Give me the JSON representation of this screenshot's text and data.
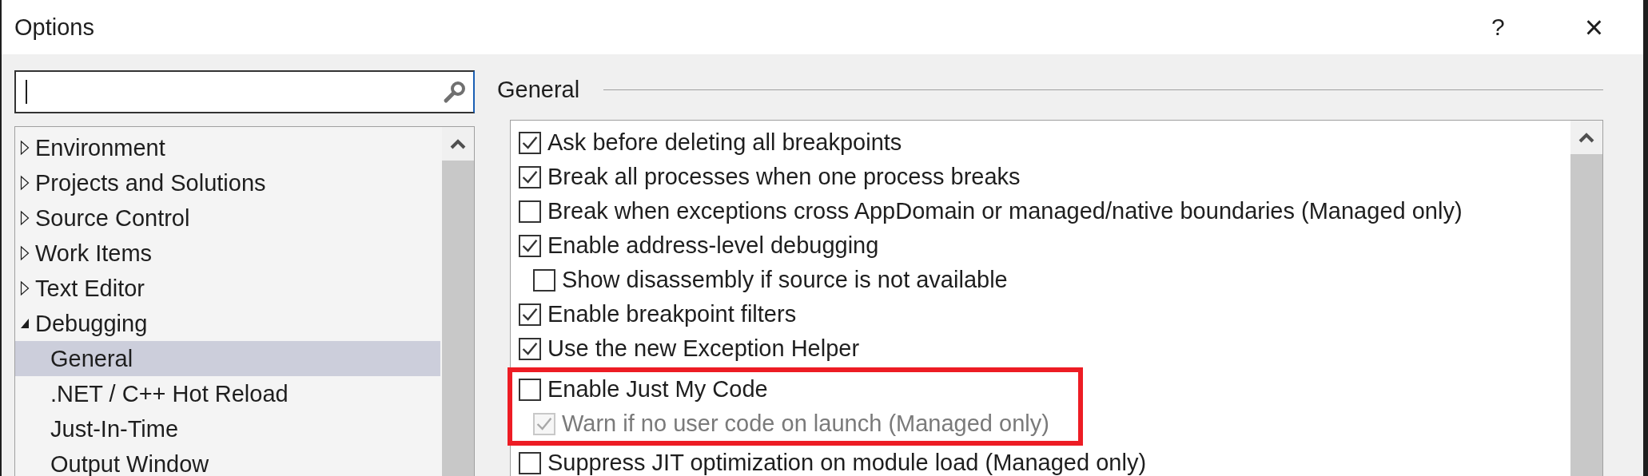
{
  "window": {
    "title": "Options",
    "help_button": "?",
    "close_button": "×"
  },
  "tree": [
    {
      "label": "Environment",
      "expanded": false,
      "selected": false
    },
    {
      "label": "Projects and Solutions",
      "expanded": false,
      "selected": false
    },
    {
      "label": "Source Control",
      "expanded": false,
      "selected": false
    },
    {
      "label": "Work Items",
      "expanded": false,
      "selected": false
    },
    {
      "label": "Text Editor",
      "expanded": false,
      "selected": false
    },
    {
      "label": "Debugging",
      "expanded": true,
      "selected": false,
      "children": [
        {
          "label": "General",
          "selected": true
        },
        {
          "label": ".NET / C++ Hot Reload",
          "selected": false
        },
        {
          "label": "Just-In-Time",
          "selected": false
        },
        {
          "label": "Output Window",
          "selected": false
        }
      ]
    }
  ],
  "page": {
    "heading": "General"
  },
  "options": [
    {
      "label": "Ask before deleting all breakpoints",
      "checked": true,
      "disabled": false,
      "highlighted": false
    },
    {
      "label": "Break all processes when one process breaks",
      "checked": true,
      "disabled": false,
      "highlighted": false
    },
    {
      "label": "Break when exceptions cross AppDomain or managed/native boundaries (Managed only)",
      "checked": false,
      "disabled": false,
      "highlighted": false
    },
    {
      "label": "Enable address-level debugging",
      "checked": true,
      "disabled": false,
      "highlighted": false,
      "children": [
        {
          "label": "Show disassembly if source is not available",
          "checked": false,
          "disabled": false,
          "highlighted": false
        }
      ]
    },
    {
      "label": "Enable breakpoint filters",
      "checked": true,
      "disabled": false,
      "highlighted": false
    },
    {
      "label": "Use the new Exception Helper",
      "checked": true,
      "disabled": false,
      "highlighted": false
    },
    {
      "label": "Enable Just My Code",
      "checked": false,
      "disabled": false,
      "highlighted": true,
      "children": [
        {
          "label": "Warn if no user code on launch (Managed only)",
          "checked": true,
          "disabled": true,
          "highlighted": true
        }
      ]
    },
    {
      "label": "Suppress JIT optimization on module load (Managed only)",
      "checked": false,
      "disabled": false,
      "highlighted": false
    }
  ]
}
